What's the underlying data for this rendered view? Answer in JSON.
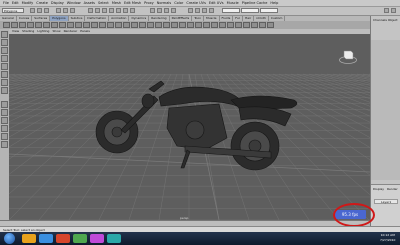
{
  "menus": [
    "File",
    "Edit",
    "Modify",
    "Create",
    "Display",
    "Window",
    "Assets",
    "Select",
    "Mesh",
    "Edit Mesh",
    "Proxy",
    "Normals",
    "Color",
    "Create UVs",
    "Edit UVs",
    "Muscle",
    "Pipeline Cache",
    "Help"
  ],
  "statusline": {
    "mode": "Polygons"
  },
  "shelf_tabs": [
    "General",
    "Curves",
    "Surfaces",
    "Polygons",
    "Subdivs",
    "Deformation",
    "Animation",
    "Dynamics",
    "Rendering",
    "PaintEffects",
    "Toon",
    "Muscle",
    "Fluids",
    "Fur",
    "Hair",
    "nCloth",
    "Custom"
  ],
  "panel_menus": [
    "View",
    "Shading",
    "Lighting",
    "Show",
    "Renderer",
    "Panels"
  ],
  "viewport": {
    "label": "persp",
    "grid_color": "#7a7a7a",
    "background": "#5e5e5e"
  },
  "fps": "95.3 fps",
  "channel_box": {
    "title": "Channels Object",
    "layer_tabs": [
      "Display",
      "Render"
    ],
    "layer": "Layer1"
  },
  "help_line": "Select Tool: select an object",
  "taskbar": {
    "time": "10:12 AM",
    "date": "7/27/2010",
    "icon_colors": [
      "#e8a21c",
      "#3a8fe0",
      "#d6452b",
      "#4fa84f",
      "#c04ad8",
      "#2aa8a8"
    ]
  },
  "accent": "#d01818"
}
